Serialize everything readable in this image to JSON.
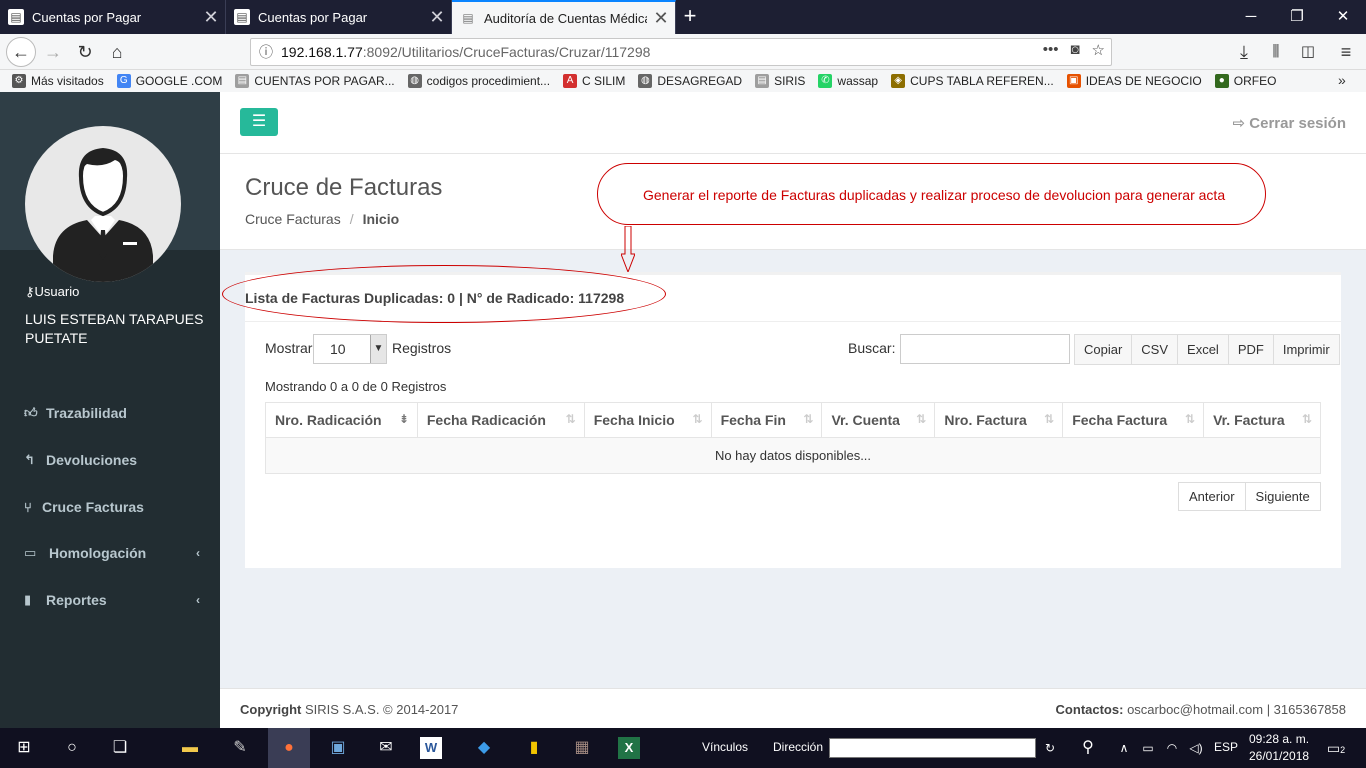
{
  "browser": {
    "tabs": [
      {
        "title": "Cuentas por Pagar",
        "active": false
      },
      {
        "title": "Cuentas por Pagar",
        "active": false
      },
      {
        "title": "Auditoría de Cuentas Médicas",
        "active": true
      }
    ],
    "url_host": "192.168.1.77",
    "url_path": ":8092/Utilitarios/CruceFacturas/Cruzar/117298",
    "bookmarks": [
      {
        "label": "Más visitados",
        "icon": "gear-icon",
        "color": "#555555"
      },
      {
        "label": "GOOGLE .COM",
        "icon": "google-icon",
        "color": "#4285f4"
      },
      {
        "label": "CUENTAS POR PAGAR...",
        "icon": "page-icon",
        "color": "#9e9e9e"
      },
      {
        "label": "codigos procedimient...",
        "icon": "globe-icon",
        "color": "#666666"
      },
      {
        "label": "C SILIM",
        "icon": "pdf-icon",
        "color": "#d32f2f"
      },
      {
        "label": "DESAGREGAD",
        "icon": "globe-icon",
        "color": "#666666"
      },
      {
        "label": "SIRIS",
        "icon": "page-icon",
        "color": "#9e9e9e"
      },
      {
        "label": "wassap",
        "icon": "whatsapp-icon",
        "color": "#25d366"
      },
      {
        "label": "CUPS TABLA REFEREN...",
        "icon": "shield-icon",
        "color": "#8d6e00"
      },
      {
        "label": "IDEAS DE NEGOCIO",
        "icon": "box-icon",
        "color": "#e65100"
      },
      {
        "label": "ORFEO",
        "icon": "orfeo-icon",
        "color": "#33691e"
      }
    ]
  },
  "sidebar": {
    "user_label": "Usuario",
    "user_name": "LUIS ESTEBAN TARAPUES PUETATE",
    "items": [
      {
        "label": "Trazabilidad",
        "icon": "thumbs-up-icon",
        "has_chevron": false
      },
      {
        "label": "Devoluciones",
        "icon": "reply-icon",
        "has_chevron": false
      },
      {
        "label": "Cruce Facturas",
        "icon": "merge-icon",
        "has_chevron": false
      },
      {
        "label": "Homologación",
        "icon": "desktop-icon",
        "has_chevron": true
      },
      {
        "label": "Reportes",
        "icon": "file-icon",
        "has_chevron": true
      }
    ]
  },
  "header": {
    "logout_label": "Cerrar sesión"
  },
  "content": {
    "title": "Cruce de Facturas",
    "breadcrumb": [
      "Cruce Facturas",
      "Inicio"
    ],
    "annotation": "Generar el reporte de Facturas duplicadas y  realizar proceso de devolucion para generar acta",
    "box_title": "Lista de Facturas Duplicadas: 0 | N° de Radicado: 117298",
    "show_label": "Mostrar",
    "show_value": "10",
    "records_label": "Registros",
    "search_label": "Buscar:",
    "export_buttons": [
      "Copiar",
      "CSV",
      "Excel",
      "PDF",
      "Imprimir"
    ],
    "info": "Mostrando 0 a 0 de 0 Registros",
    "columns": [
      "Nro. Radicación",
      "Fecha Radicación",
      "Fecha Inicio",
      "Fecha Fin",
      "Vr. Cuenta",
      "Nro. Factura",
      "Fecha Factura",
      "Vr. Factura"
    ],
    "empty_message": "No hay datos disponibles...",
    "prev_label": "Anterior",
    "next_label": "Siguiente"
  },
  "footer": {
    "copyright_bold": "Copyright",
    "copyright_text": "SIRIS S.A.S. © 2014-2017",
    "contact_bold": "Contactos:",
    "contact_text": "oscarboc@hotmail.com | 3165367858"
  },
  "taskbar": {
    "vinculos": "Vínculos",
    "direccion": "Dirección",
    "lang": "ESP",
    "time": "09:28 a. m.",
    "date": "26/01/2018",
    "notif_count": "2"
  },
  "colors": {
    "accent": "#26b99a",
    "sidebar": "#222d32",
    "annotation": "#cc0000"
  }
}
